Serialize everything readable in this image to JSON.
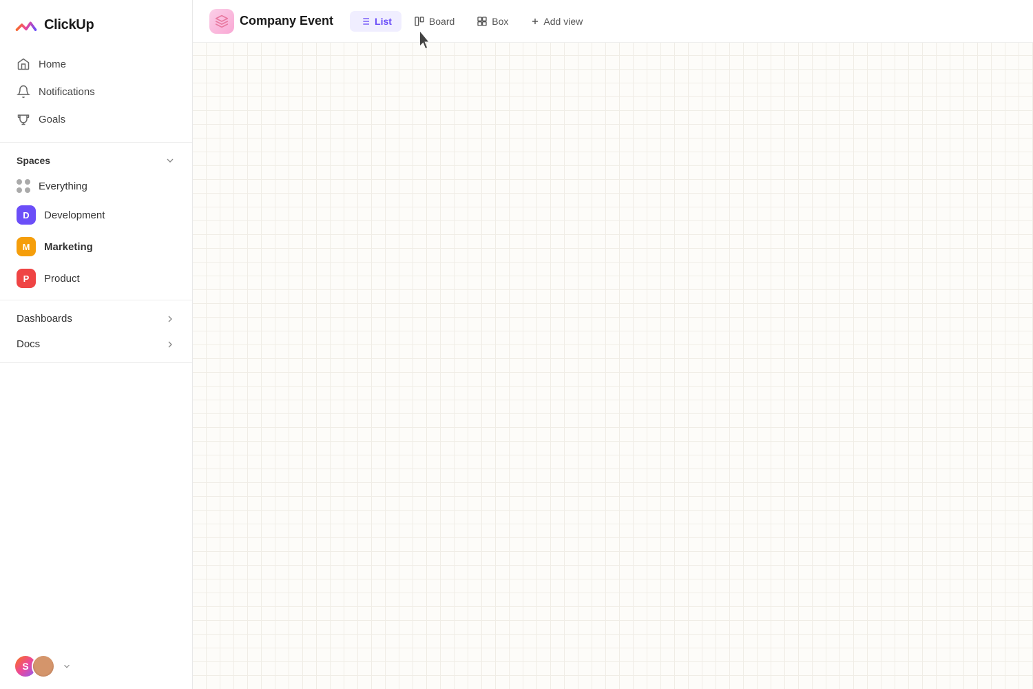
{
  "app": {
    "name": "ClickUp"
  },
  "sidebar": {
    "nav_items": [
      {
        "id": "home",
        "label": "Home",
        "icon": "home-icon"
      },
      {
        "id": "notifications",
        "label": "Notifications",
        "icon": "bell-icon"
      },
      {
        "id": "goals",
        "label": "Goals",
        "icon": "trophy-icon"
      }
    ],
    "spaces_label": "Spaces",
    "spaces": [
      {
        "id": "everything",
        "label": "Everything",
        "type": "dots"
      },
      {
        "id": "development",
        "label": "Development",
        "badge": "D",
        "color": "#6b4ef8"
      },
      {
        "id": "marketing",
        "label": "Marketing",
        "badge": "M",
        "color": "#f59e0b",
        "active": true
      },
      {
        "id": "product",
        "label": "Product",
        "badge": "P",
        "color": "#ef4444"
      }
    ],
    "expandable": [
      {
        "id": "dashboards",
        "label": "Dashboards"
      },
      {
        "id": "docs",
        "label": "Docs"
      }
    ]
  },
  "topbar": {
    "project_title": "Company Event",
    "views": [
      {
        "id": "list",
        "label": "List",
        "active": true
      },
      {
        "id": "board",
        "label": "Board",
        "active": false
      },
      {
        "id": "box",
        "label": "Box",
        "active": false
      }
    ],
    "add_view_label": "Add view"
  }
}
